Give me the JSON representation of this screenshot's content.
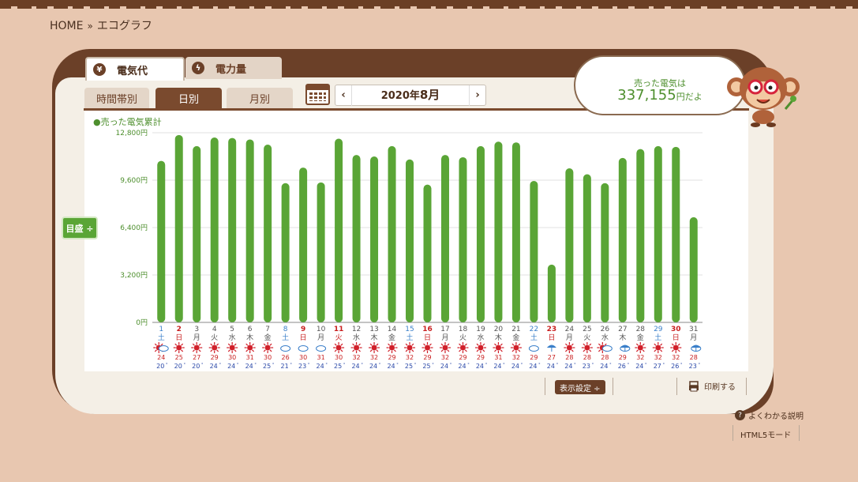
{
  "breadcrumb": {
    "home": "HOME",
    "sep": "»",
    "current": "エコグラフ"
  },
  "top_tabs": [
    {
      "label": "電気代",
      "icon": "yen-icon",
      "glyph": "¥"
    },
    {
      "label": "電力量",
      "icon": "lightning-icon",
      "glyph": "ϟ"
    }
  ],
  "sub_tabs": [
    "時間帯別",
    "日別",
    "月別"
  ],
  "month_nav": {
    "year": "2020年",
    "month": "8月",
    "prev": "‹",
    "next": "›"
  },
  "legend": "●売った電気累計",
  "meta_button": "目盛 ÷",
  "bubble": {
    "line1": "売った電気は",
    "amount": "337,155",
    "suffix": "円だよ"
  },
  "display_settings": "表示設定 ÷",
  "print": "印刷する",
  "help": "よくわかる説明",
  "html5": "HTML5モード",
  "colors": {
    "bar": "#5aa536",
    "weekday": "#555555",
    "saturday": "#3a7fc9",
    "sunday": "#c81e1e",
    "high_temp": "#c81e1e",
    "low_temp": "#2a48a8"
  },
  "chart_data": {
    "type": "bar",
    "ylim": [
      0,
      12800
    ],
    "yticks": [
      "0円",
      "3,200円",
      "6,400円",
      "9,600円",
      "12,800円"
    ],
    "days": [
      "1",
      "2",
      "3",
      "4",
      "5",
      "6",
      "7",
      "8",
      "9",
      "10",
      "11",
      "12",
      "13",
      "14",
      "15",
      "16",
      "17",
      "18",
      "19",
      "20",
      "21",
      "22",
      "23",
      "24",
      "25",
      "26",
      "27",
      "28",
      "29",
      "30",
      "31"
    ],
    "weekdays": [
      "土",
      "日",
      "月",
      "火",
      "水",
      "木",
      "金",
      "土",
      "日",
      "月",
      "火",
      "水",
      "木",
      "金",
      "土",
      "日",
      "月",
      "火",
      "水",
      "木",
      "金",
      "土",
      "日",
      "月",
      "火",
      "水",
      "木",
      "金",
      "土",
      "日",
      "月"
    ],
    "day_type": [
      "sat",
      "sun",
      "wd",
      "wd",
      "wd",
      "wd",
      "wd",
      "sat",
      "sun",
      "wd",
      "hol",
      "wd",
      "wd",
      "wd",
      "sat",
      "sun",
      "wd",
      "wd",
      "wd",
      "wd",
      "wd",
      "sat",
      "sun",
      "wd",
      "wd",
      "wd",
      "wd",
      "wd",
      "sat",
      "sun",
      "wd"
    ],
    "values": [
      10900,
      12650,
      11900,
      12480,
      12450,
      12350,
      12000,
      9400,
      10450,
      9450,
      12400,
      11300,
      11200,
      11900,
      11000,
      9300,
      11300,
      11150,
      11900,
      12200,
      12150,
      9550,
      3900,
      10400,
      10000,
      9400,
      11100,
      11700,
      11900,
      11850,
      7100
    ],
    "weather": [
      "cloudy-sun",
      "sun",
      "sun",
      "sun",
      "sun",
      "sun",
      "sun",
      "cloudy",
      "cloudy",
      "cloudy",
      "sun",
      "sun",
      "sun",
      "sun",
      "sun",
      "sun",
      "sun",
      "sun",
      "sun",
      "sun",
      "sun",
      "cloudy",
      "rain",
      "sun",
      "sun",
      "cloudy-sun",
      "cloudy-rain",
      "sun",
      "sun",
      "sun",
      "cloudy-rain"
    ],
    "high_temp": [
      "24",
      "25",
      "27",
      "29",
      "30",
      "31",
      "30",
      "26",
      "30",
      "31",
      "30",
      "32",
      "32",
      "29",
      "32",
      "29",
      "32",
      "29",
      "29",
      "31",
      "32",
      "29",
      "27",
      "28",
      "28",
      "28",
      "29",
      "32",
      "32",
      "32",
      "28"
    ],
    "low_temp": [
      "20",
      "20",
      "20",
      "24",
      "24",
      "24",
      "25",
      "21",
      "23",
      "24",
      "25",
      "24",
      "24",
      "24",
      "25",
      "25",
      "24",
      "24",
      "24",
      "24",
      "24",
      "24",
      "24",
      "24",
      "23",
      "24",
      "26",
      "24",
      "27",
      "26",
      "23"
    ]
  }
}
